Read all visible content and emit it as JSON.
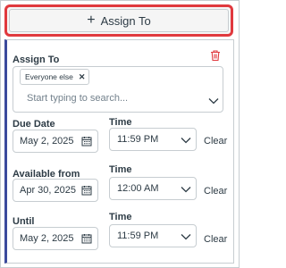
{
  "assign_button": {
    "icon": "plus-icon",
    "label": "Assign To"
  },
  "assign_section": {
    "label": "Assign To",
    "chips": [
      {
        "label": "Everyone else"
      }
    ],
    "search_placeholder": "Start typing to search...",
    "delete_icon": "trash-icon",
    "delete_color": "#e0393e"
  },
  "rows": [
    {
      "date_label": "Due Date",
      "date_value": "May 2, 2025",
      "time_label": "Time",
      "time_value": "11:59 PM",
      "clear_label": "Clear"
    },
    {
      "date_label": "Available from",
      "date_value": "Apr 30, 2025",
      "time_label": "Time",
      "time_value": "12:00 AM",
      "clear_label": "Clear"
    },
    {
      "date_label": "Until",
      "date_value": "May 2, 2025",
      "time_label": "Time",
      "time_value": "11:59 PM",
      "clear_label": "Clear"
    }
  ],
  "colors": {
    "highlight_border": "#e0393e",
    "card_accent": "#3b4a9c"
  }
}
